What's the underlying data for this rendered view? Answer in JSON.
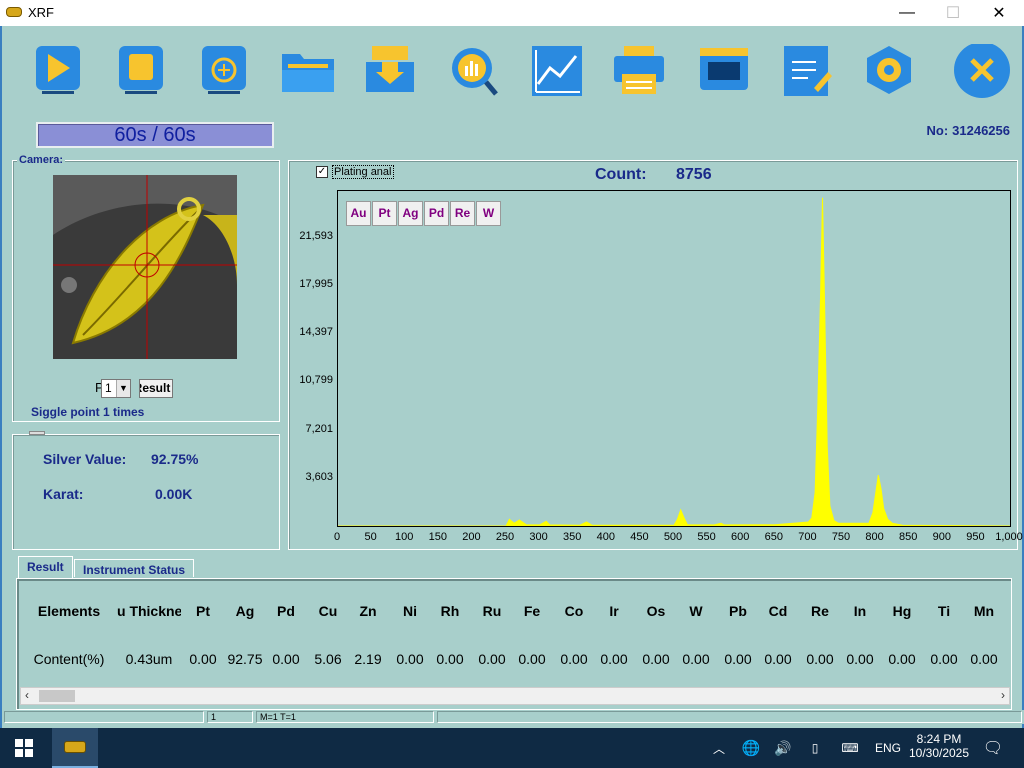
{
  "window": {
    "title": "XRF"
  },
  "window_controls": {
    "minimize": "—",
    "maximize": "☐",
    "close": "✕"
  },
  "toolbar": {
    "buttons": [
      {
        "name": "start"
      },
      {
        "name": "stop"
      },
      {
        "name": "calibrate"
      },
      {
        "name": "open"
      },
      {
        "name": "import"
      },
      {
        "name": "analyze"
      },
      {
        "name": "curve"
      },
      {
        "name": "print"
      },
      {
        "name": "display"
      },
      {
        "name": "report"
      },
      {
        "name": "settings"
      },
      {
        "name": "exit"
      }
    ]
  },
  "timer": {
    "text": "60s / 60s",
    "progress": 1.0
  },
  "serial": {
    "label": "No:",
    "value": "31246256"
  },
  "camera": {
    "label": "Camera:"
  },
  "controls": {
    "point_label": "P",
    "point_select": "1",
    "result_button": "Result",
    "single_point_text": "Siggle point 1 times"
  },
  "values": {
    "silver_label": "Silver Value:",
    "silver_value": "92.75%",
    "karat_label": "Karat:",
    "karat_value": "0.00K"
  },
  "chart_panel": {
    "plating_label": "Plating anal",
    "plating_checked": true,
    "count_label": "Count:",
    "count_value": "8756"
  },
  "element_buttons": [
    "Au",
    "Pt",
    "Ag",
    "Pd",
    "Re",
    "W"
  ],
  "chart_data": {
    "type": "area",
    "x_ticks": [
      "0",
      "50",
      "100",
      "150",
      "200",
      "250",
      "300",
      "350",
      "400",
      "450",
      "500",
      "550",
      "600",
      "650",
      "700",
      "750",
      "800",
      "850",
      "900",
      "950",
      "1,000"
    ],
    "y_ticks": [
      "3,603",
      "7,201",
      "10,799",
      "14,397",
      "17,995",
      "21,593"
    ],
    "xlim": [
      0,
      1000
    ],
    "ylim": [
      0,
      25000
    ],
    "color": "#ffff00",
    "points": [
      [
        0,
        0
      ],
      [
        250,
        0
      ],
      [
        255,
        500
      ],
      [
        262,
        200
      ],
      [
        270,
        450
      ],
      [
        280,
        100
      ],
      [
        300,
        80
      ],
      [
        310,
        350
      ],
      [
        315,
        80
      ],
      [
        360,
        60
      ],
      [
        370,
        300
      ],
      [
        378,
        60
      ],
      [
        500,
        60
      ],
      [
        505,
        500
      ],
      [
        510,
        1200
      ],
      [
        515,
        600
      ],
      [
        520,
        100
      ],
      [
        560,
        80
      ],
      [
        570,
        200
      ],
      [
        575,
        80
      ],
      [
        650,
        100
      ],
      [
        700,
        300
      ],
      [
        705,
        600
      ],
      [
        710,
        2500
      ],
      [
        714,
        9000
      ],
      [
        718,
        17000
      ],
      [
        721,
        24500
      ],
      [
        724,
        17000
      ],
      [
        728,
        6000
      ],
      [
        732,
        1500
      ],
      [
        738,
        400
      ],
      [
        745,
        200
      ],
      [
        790,
        200
      ],
      [
        796,
        1000
      ],
      [
        800,
        2400
      ],
      [
        804,
        3800
      ],
      [
        808,
        2800
      ],
      [
        812,
        1300
      ],
      [
        818,
        500
      ],
      [
        825,
        200
      ],
      [
        840,
        60
      ],
      [
        1000,
        0
      ]
    ]
  },
  "tabs": {
    "result": "Result",
    "status": "Instrument Status"
  },
  "result_table": {
    "headers": [
      "Elements",
      "u Thicknes",
      "Pt",
      "Ag",
      "Pd",
      "Cu",
      "Zn",
      "Ni",
      "Rh",
      "Ru",
      "Fe",
      "Co",
      "Ir",
      "Os",
      "W",
      "Pb",
      "Cd",
      "Re",
      "In",
      "Hg",
      "Ti",
      "Mn"
    ],
    "values": [
      "Content(%)",
      "0.43um",
      "0.00",
      "92.75",
      "0.00",
      "5.06",
      "2.19",
      "0.00",
      "0.00",
      "0.00",
      "0.00",
      "0.00",
      "0.00",
      "0.00",
      "0.00",
      "0.00",
      "0.00",
      "0.00",
      "0.00",
      "0.00",
      "0.00",
      "0.00"
    ]
  },
  "statusbar": {
    "cell1": "1",
    "cell2": "M=1 T=1"
  },
  "taskbar": {
    "lang": "ENG",
    "time": "8:24 PM",
    "date": "10/30/2025"
  }
}
